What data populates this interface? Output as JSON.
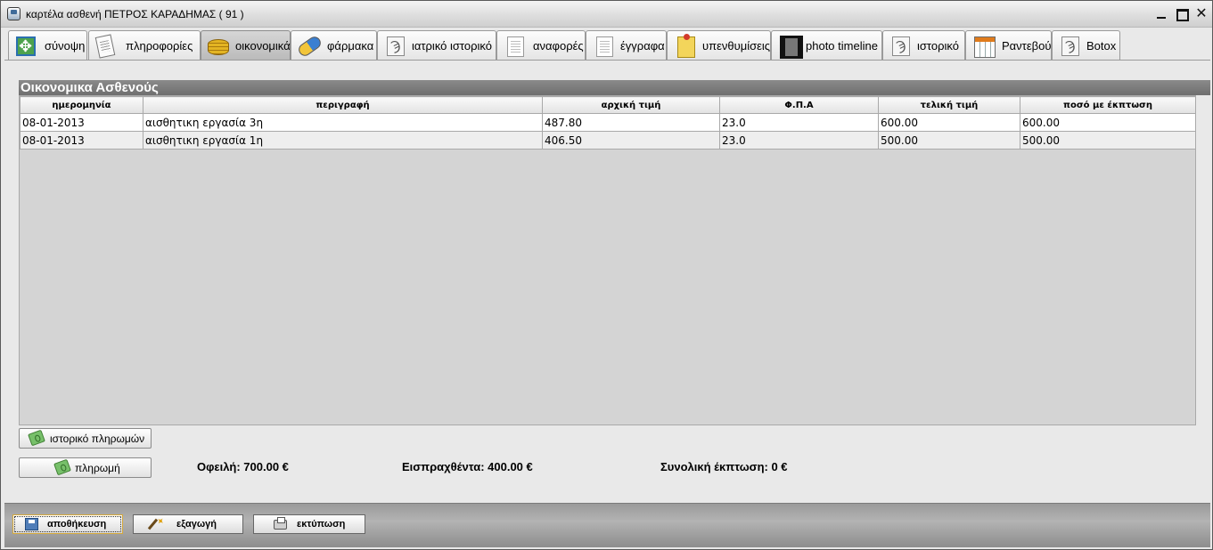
{
  "window": {
    "title": "καρτέλα ασθενή ΠΕΤΡΟΣ ΚΑΡΑΔΗΜΑΣ ( 91 )"
  },
  "tabs": [
    {
      "label": "σύνοψη",
      "icon": "summary-icon"
    },
    {
      "label": "πληροφορίες",
      "icon": "info-document-icon"
    },
    {
      "label": "οικονομικά",
      "icon": "coins-icon",
      "active": true
    },
    {
      "label": "φάρμακα",
      "icon": "pill-icon"
    },
    {
      "label": "ιατρικό ιστορικό",
      "icon": "stethoscope-icon"
    },
    {
      "label": "αναφορές",
      "icon": "reports-icon"
    },
    {
      "label": "έγγραφα",
      "icon": "document-icon"
    },
    {
      "label": "υπενθυμίσεις",
      "icon": "sticky-note-icon"
    },
    {
      "label": "photo timeline",
      "icon": "film-icon"
    },
    {
      "label": "ιστορικό",
      "icon": "stethoscope-icon"
    },
    {
      "label": "Ραντεβού",
      "icon": "calendar-icon"
    },
    {
      "label": "Botox",
      "icon": "stethoscope-icon"
    }
  ],
  "finance": {
    "section_title": "Οικονομικα Ασθενούς",
    "columns": [
      "ημερομηνία",
      "περιγραφή",
      "αρχική τιμή",
      "Φ.Π.Α",
      "τελική τιμή",
      "ποσό με έκπτωση"
    ],
    "rows": [
      [
        "08-01-2013",
        "αισθητικη εργασία 3η",
        "487.80",
        "23.0",
        "600.00",
        "600.00"
      ],
      [
        "08-01-2013",
        "αισθητικη εργασία 1η",
        "406.50",
        "23.0",
        "500.00",
        "500.00"
      ]
    ],
    "payment_history_label": "ιστορικό πληρωμών",
    "payment_label": "πληρωμή",
    "owed": "Οφειλή: 700.00 €",
    "collected": "Εισπραχθέντα: 400.00 €",
    "total_discount": "Συνολική έκπτωση: 0 €"
  },
  "bottom": {
    "save_label": "αποθήκευση",
    "export_label": "εξαγωγή",
    "print_label": "εκτύπωση"
  },
  "colors": {
    "section_header": "#7a7a7a",
    "table_empty_area": "#d4d4d4",
    "bottom_bar": "#9a9a9a"
  }
}
